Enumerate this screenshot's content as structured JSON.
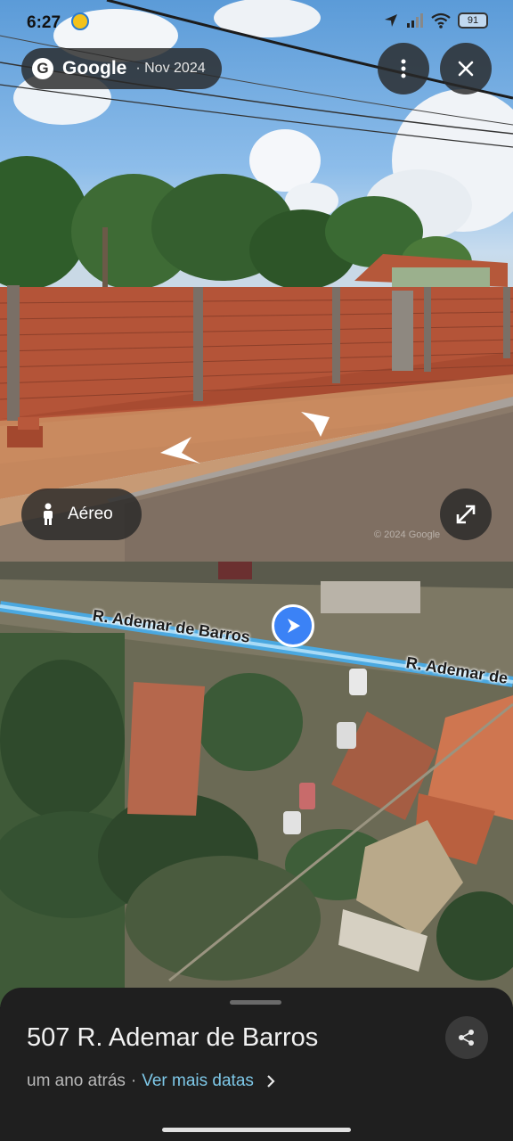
{
  "status_bar": {
    "time": "6:27",
    "battery": "91"
  },
  "street_view": {
    "brand": "Google",
    "date": "· Nov 2024",
    "mode_label": "Aéreo",
    "watermark": "© 2024 Google",
    "icons": [
      "more-vert-icon",
      "close-icon",
      "person-icon",
      "expand-icon",
      "nav-arrow-left-icon",
      "nav-arrow-right-icon"
    ]
  },
  "map": {
    "street_label_1": "R. Ademar de Barros",
    "street_label_2": "R. Ademar de",
    "colors": {
      "road_line": "#4aa8e0",
      "location_marker": "#3b82f6"
    }
  },
  "sheet": {
    "address": "507 R. Ademar de Barros",
    "time_ago": "um ano atrás",
    "separator": "·",
    "more_dates_link": "Ver mais datas"
  },
  "colors": {
    "link": "#7ec8e8",
    "sheet_bg": "#1f1f1f",
    "chip_bg": "#282828"
  }
}
